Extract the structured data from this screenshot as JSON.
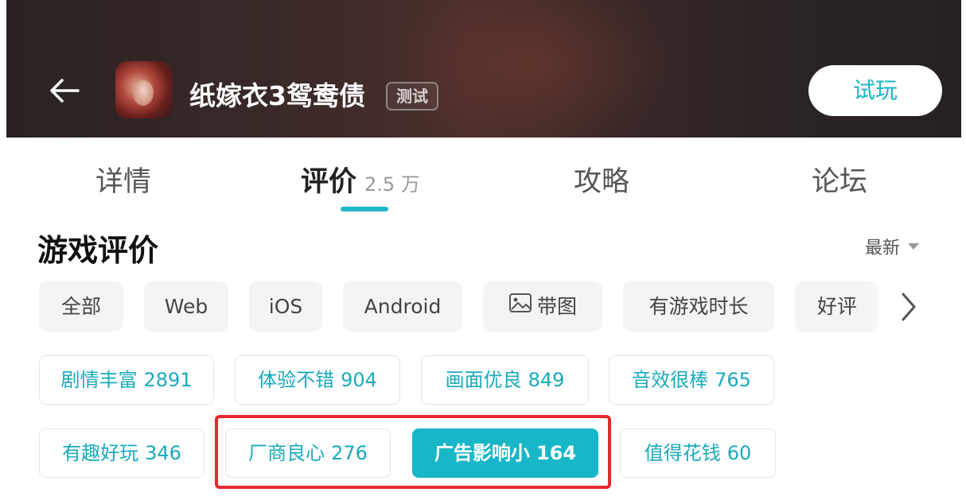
{
  "header": {
    "title": "纸嫁衣3鸳鸯债",
    "badge": "测试",
    "trial_label": "试玩"
  },
  "tabs": [
    {
      "label": "详情"
    },
    {
      "label": "评价",
      "count": "2.5 万"
    },
    {
      "label": "攻略"
    },
    {
      "label": "论坛"
    }
  ],
  "section": {
    "title": "游戏评价",
    "sort_label": "最新"
  },
  "filters": [
    "全部",
    "Web",
    "iOS",
    "Android",
    "带图",
    "有游戏时长",
    "好评"
  ],
  "tags": [
    {
      "label": "剧情丰富",
      "count": "2891"
    },
    {
      "label": "体验不错",
      "count": "904"
    },
    {
      "label": "画面优良",
      "count": "849"
    },
    {
      "label": "音效很棒",
      "count": "765"
    },
    {
      "label": "有趣好玩",
      "count": "346"
    },
    {
      "label": "厂商良心",
      "count": "276"
    },
    {
      "label": "广告影响小",
      "count": "164"
    },
    {
      "label": "值得花钱",
      "count": "60"
    }
  ],
  "colors": {
    "accent": "#17b7c7",
    "highlight": "#e5282c",
    "header_bg": "#2a2222"
  },
  "icons": [
    "back-arrow-icon",
    "image-icon",
    "chevron-right-icon",
    "sort-caret-icon"
  ]
}
